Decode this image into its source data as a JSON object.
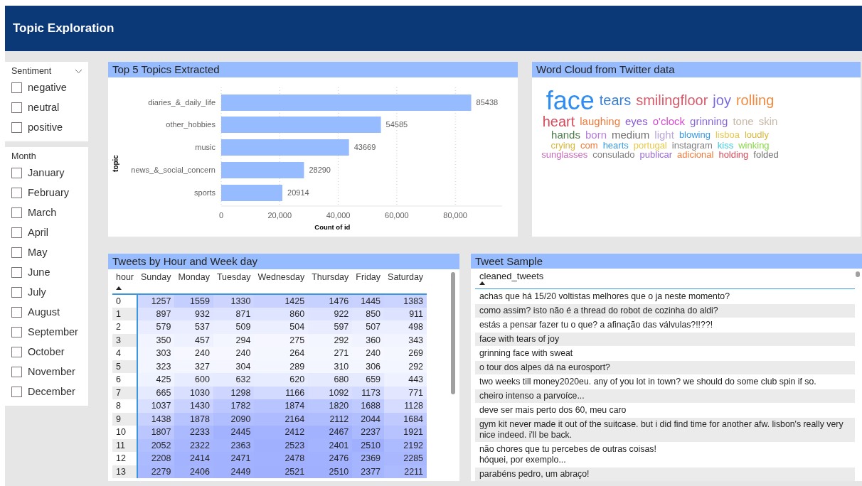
{
  "header": {
    "title": "Topic Exploration"
  },
  "slicers": [
    {
      "title": "Sentiment",
      "dropdown": true,
      "items": [
        {
          "label": "negative",
          "checked": false
        },
        {
          "label": "neutral",
          "checked": false
        },
        {
          "label": "positive",
          "checked": false
        }
      ]
    },
    {
      "title": "Month",
      "dropdown": false,
      "items": [
        {
          "label": "January",
          "checked": false
        },
        {
          "label": "February",
          "checked": false
        },
        {
          "label": "March",
          "checked": false
        },
        {
          "label": "April",
          "checked": false
        },
        {
          "label": "May",
          "checked": false
        },
        {
          "label": "June",
          "checked": false
        },
        {
          "label": "July",
          "checked": false
        },
        {
          "label": "August",
          "checked": false
        },
        {
          "label": "September",
          "checked": false
        },
        {
          "label": "October",
          "checked": false
        },
        {
          "label": "November",
          "checked": false
        },
        {
          "label": "December",
          "checked": false
        }
      ]
    }
  ],
  "topics_panel": {
    "title": "Top 5 Topics Extracted",
    "chart_data": {
      "type": "bar",
      "orientation": "horizontal",
      "xlabel": "Count of id",
      "ylabel": "topic",
      "categories": [
        "diaries_&_daily_life",
        "other_hobbies",
        "music",
        "news_&_social_concern",
        "sports"
      ],
      "values": [
        85438,
        54585,
        43669,
        28290,
        20914
      ],
      "grid": true,
      "xlim": [
        0,
        96000
      ],
      "xticks": [
        {
          "value": 0,
          "label": "0"
        },
        {
          "value": 20000,
          "label": "20,000"
        },
        {
          "value": 40000,
          "label": "40,000"
        },
        {
          "value": 60000,
          "label": "60,000"
        },
        {
          "value": 80000,
          "label": "80,000"
        }
      ],
      "data_labels": true
    }
  },
  "wordcloud_panel": {
    "title": "Word Cloud from Twitter data",
    "words": [
      {
        "text": "face",
        "color": "#2f8cf0"
      },
      {
        "text": "tears",
        "color": "#3a7fd6"
      },
      {
        "text": "smilingfloor",
        "color": "#d65a6a"
      },
      {
        "text": "joy",
        "color": "#7a6ae0"
      },
      {
        "text": "rolling",
        "color": "#f08a40"
      },
      {
        "text": "heart",
        "color": "#d64a5a"
      },
      {
        "text": "laughing",
        "color": "#f07a3a"
      },
      {
        "text": "eyes",
        "color": "#8a5ad6"
      },
      {
        "text": "o'clock",
        "color": "#d84ad0"
      },
      {
        "text": "grinning",
        "color": "#8a6ad6"
      },
      {
        "text": "tone",
        "color": "#c8b8a8"
      },
      {
        "text": "skin",
        "color": "#c8b8a8"
      },
      {
        "text": "hands",
        "color": "#4a7a4a"
      },
      {
        "text": "born",
        "color": "#b87ae0"
      },
      {
        "text": "medium",
        "color": "#707070"
      },
      {
        "text": "light",
        "color": "#b8a8d8"
      },
      {
        "text": "blowing",
        "color": "#3a9ae0"
      },
      {
        "text": "lisboa",
        "color": "#e8c84a"
      },
      {
        "text": "loudly",
        "color": "#d8b83a"
      },
      {
        "text": "crying",
        "color": "#d8b83a"
      },
      {
        "text": "com",
        "color": "#f07a3a"
      },
      {
        "text": "hearts",
        "color": "#3a9ae0"
      },
      {
        "text": "portugal",
        "color": "#e8c84a"
      },
      {
        "text": "instagram",
        "color": "#808080"
      },
      {
        "text": "kiss",
        "color": "#3ac8e0"
      },
      {
        "text": "winking",
        "color": "#8ad84a"
      },
      {
        "text": "sunglasses",
        "color": "#c86ab8"
      },
      {
        "text": "consulado",
        "color": "#808080"
      },
      {
        "text": "publicar",
        "color": "#9a6ad6"
      },
      {
        "text": "adicional",
        "color": "#f07a3a"
      },
      {
        "text": "holding",
        "color": "#d64a5a"
      },
      {
        "text": "folded",
        "color": "#707070"
      }
    ]
  },
  "hours_panel": {
    "title": "Tweets by Hour and Week day",
    "columns": [
      "hour",
      "Sunday",
      "Monday",
      "Tuesday",
      "Wednesday",
      "Thursday",
      "Friday",
      "Saturday"
    ],
    "rows": [
      [
        "0",
        "1257",
        "1559",
        "1330",
        "1425",
        "1476",
        "1445",
        "1383"
      ],
      [
        "1",
        "897",
        "932",
        "871",
        "860",
        "922",
        "850",
        "911"
      ],
      [
        "2",
        "579",
        "537",
        "509",
        "504",
        "597",
        "507",
        "498"
      ],
      [
        "3",
        "350",
        "457",
        "294",
        "275",
        "292",
        "360",
        "343"
      ],
      [
        "4",
        "303",
        "240",
        "240",
        "264",
        "271",
        "240",
        "269"
      ],
      [
        "5",
        "323",
        "327",
        "304",
        "289",
        "310",
        "306",
        "292"
      ],
      [
        "6",
        "425",
        "600",
        "632",
        "620",
        "680",
        "659",
        "443"
      ],
      [
        "7",
        "665",
        "1030",
        "1298",
        "1166",
        "1092",
        "1173",
        "771"
      ],
      [
        "8",
        "1037",
        "1430",
        "1782",
        "1874",
        "1820",
        "1688",
        "1128"
      ],
      [
        "9",
        "1438",
        "1878",
        "2090",
        "2164",
        "2112",
        "2044",
        "1684"
      ],
      [
        "10",
        "1807",
        "2233",
        "2445",
        "2412",
        "2467",
        "2237",
        "1921"
      ],
      [
        "11",
        "2052",
        "2322",
        "2363",
        "2523",
        "2401",
        "2510",
        "2192"
      ],
      [
        "12",
        "2208",
        "2414",
        "2471",
        "2478",
        "2476",
        "2369",
        "2285"
      ],
      [
        "13",
        "2279",
        "2406",
        "2449",
        "2521",
        "2510",
        "2377",
        "2211"
      ]
    ]
  },
  "tweets_panel": {
    "title": "Tweet Sample",
    "column": "cleaned_tweets",
    "rows": [
      "achas que há 15/20 voltistas melhores que o ja neste momento?",
      "como assim? isto não é a thread do robot de cozinha do aldi?",
      "estás a pensar fazer tu o que? a afinação das válvulas?!!??!",
      "face with tears of joy",
      "grinning face with sweat",
      "o tour dos alpes dá na eurosport?",
      "two weeks till money2020eu. any of you lot in town? we should do some club spin if so.",
      "cheiro intenso a parvoíce...",
      "deve ser mais perto dos 60, meu caro",
      "gym kit never made it out of the suitcase. but i did find time for another afw. lisbon's really very nice indeed. i'll be back.",
      "não chores que tu percebes de outras coisas!\nhóquei, por exemplo...",
      "parabéns pedro, um abraço!"
    ]
  }
}
